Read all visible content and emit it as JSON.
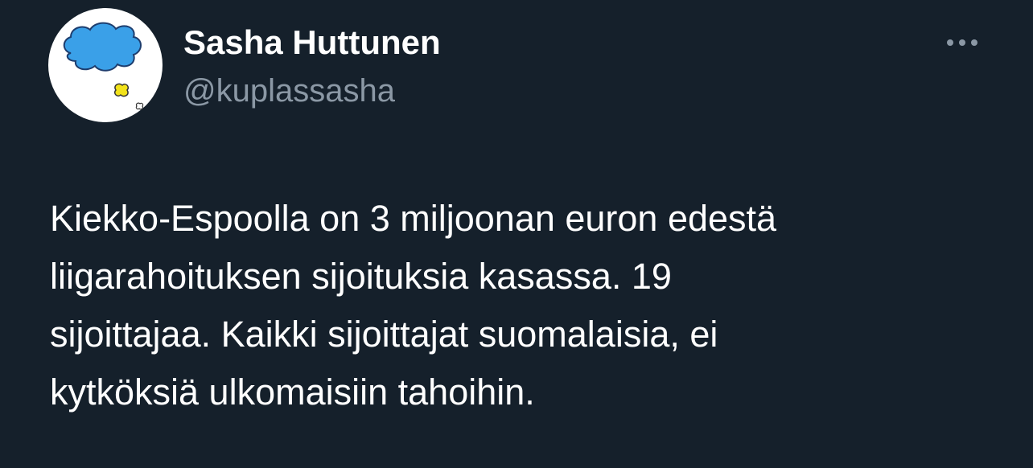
{
  "user": {
    "display_name": "Sasha Huttunen",
    "handle": "@kuplassasha",
    "avatar_icon": "cloud-thought-bubble-icon"
  },
  "menu": {
    "icon": "more-horizontal-icon"
  },
  "tweet": {
    "lines": [
      "Kiekko-Espoolla on 3 miljoonan euron edestä",
      "liigarahoituksen sijoituksia kasassa. 19",
      "sijoittajaa. Kaikki sijoittajat suomalaisia, ei",
      "kytköksiä ulkomaisiin tahoihin."
    ]
  },
  "colors": {
    "background": "#15202b",
    "text_primary": "#ffffff",
    "text_secondary": "#8b98a5",
    "avatar_cloud": "#3aa0e8",
    "avatar_accent": "#f2e21a"
  }
}
